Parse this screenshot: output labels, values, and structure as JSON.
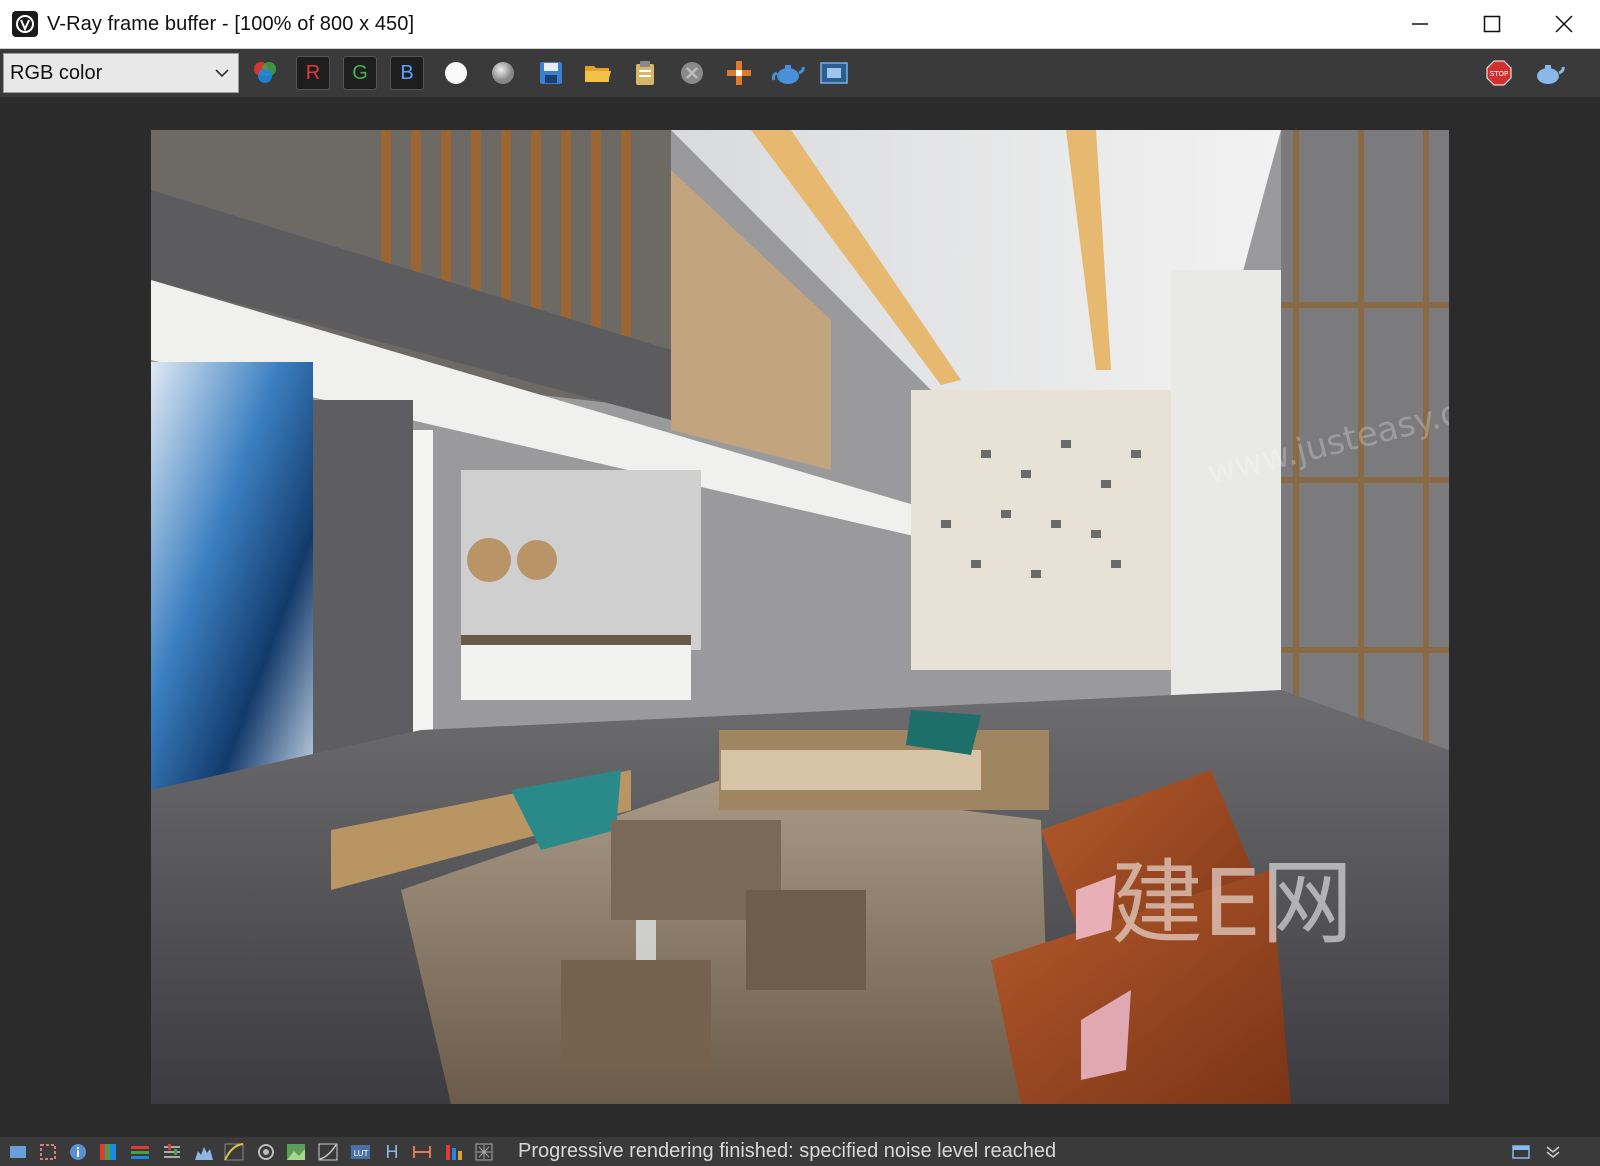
{
  "window": {
    "title": "V-Ray frame buffer - [100% of 800 x 450]"
  },
  "toolbar": {
    "channel_selected": "RGB color",
    "red_label": "R",
    "green_label": "G",
    "blue_label": "B",
    "buttons": [
      "color-corrections-icon",
      "red-channel",
      "green-channel",
      "blue-channel",
      "white-point-icon",
      "gray-point-icon",
      "save-image-icon",
      "open-image-icon",
      "copy-clipboard-icon",
      "clear-image-icon",
      "track-mouse-icon",
      "render-teapot-icon",
      "vfb-history-icon",
      "stop-render-icon",
      "render-last-icon"
    ],
    "stop_label": "STOP"
  },
  "render": {
    "watermark_brand": "建E网",
    "watermark_url": "www.justeasy.cn"
  },
  "statusbar": {
    "message": "Progressive rendering finished: specified noise level reached",
    "h_label": "H"
  },
  "colors": {
    "chrome_dark": "#2b2b2b",
    "toolbar": "#3a3a3a",
    "red": "#e23b3b",
    "green": "#4caf50",
    "blue": "#5aa0ff",
    "stop": "#d32f2f"
  }
}
